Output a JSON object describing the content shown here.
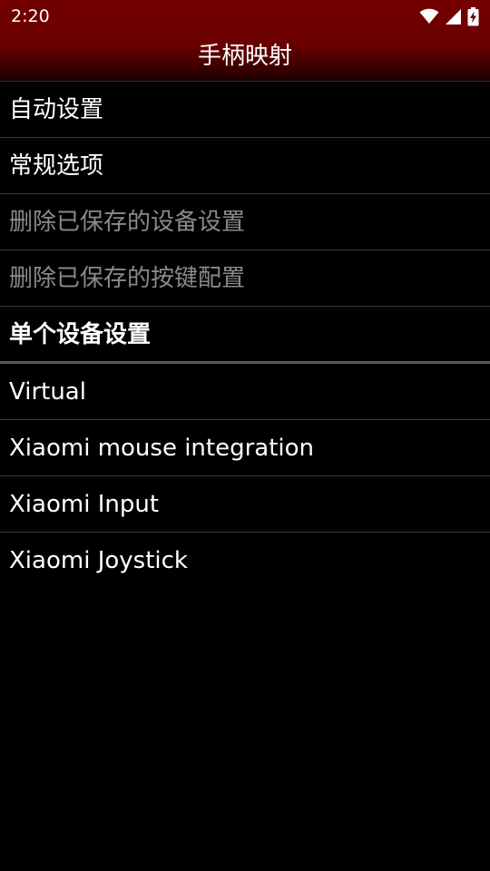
{
  "status_bar": {
    "time": "2:20",
    "icons": [
      "wifi-icon",
      "cellular-signal-icon",
      "battery-charging-icon"
    ]
  },
  "app_bar": {
    "title": "手柄映射"
  },
  "colors": {
    "app_bar": "#6a0000",
    "background": "#000000",
    "text_primary": "#ffffff",
    "text_disabled": "#8a8a8a",
    "divider": "#3a3a3a"
  },
  "menu": {
    "auto_settings": "自动设置",
    "general_options": "常规选项",
    "delete_saved_device_settings": "删除已保存的设备设置",
    "delete_saved_key_config": "删除已保存的按键配置"
  },
  "section": {
    "per_device_settings": "单个设备设置"
  },
  "devices": [
    {
      "label": "Virtual"
    },
    {
      "label": "Xiaomi mouse integration"
    },
    {
      "label": "Xiaomi Input"
    },
    {
      "label": "Xiaomi Joystick"
    }
  ]
}
